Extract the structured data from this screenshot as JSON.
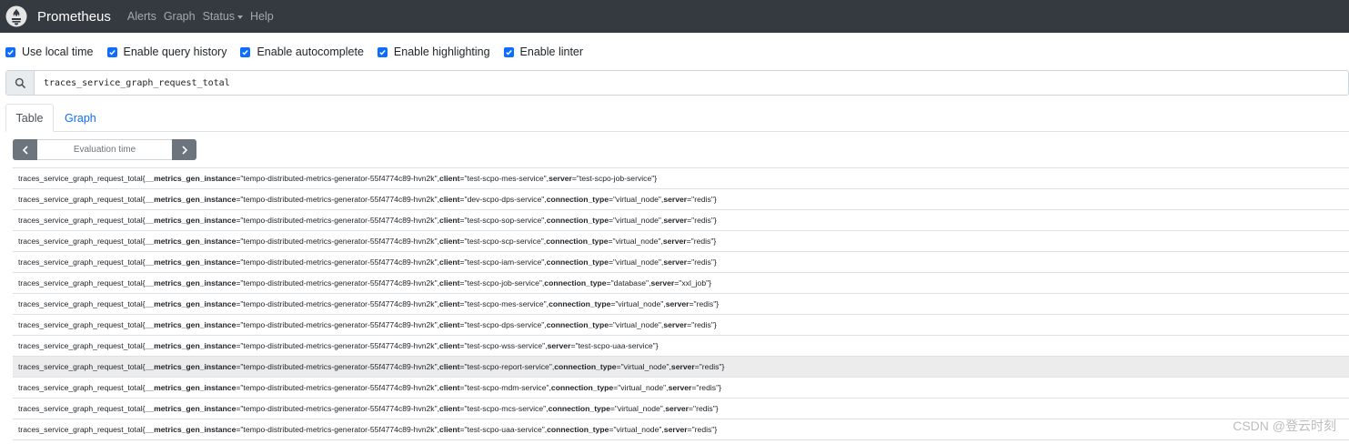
{
  "navbar": {
    "brand": "Prometheus",
    "links": {
      "alerts": "Alerts",
      "graph": "Graph",
      "status": "Status",
      "help": "Help"
    },
    "logo_icon": "prometheus-flame-icon"
  },
  "options": [
    {
      "label": "Use local time",
      "checked": true
    },
    {
      "label": "Enable query history",
      "checked": true
    },
    {
      "label": "Enable autocomplete",
      "checked": true
    },
    {
      "label": "Enable highlighting",
      "checked": true
    },
    {
      "label": "Enable linter",
      "checked": true
    }
  ],
  "query": {
    "value": "traces_service_graph_request_total",
    "icon": "search-icon"
  },
  "tabs": {
    "table": "Table",
    "graph": "Graph",
    "active": "table"
  },
  "eval": {
    "placeholder": "Evaluation time",
    "prev_icon": "chevron-left-icon",
    "next_icon": "chevron-right-icon"
  },
  "colors": {
    "navbar": "#343a40",
    "accent": "#0d6efd",
    "button": "#6c757d",
    "highlight_row": "#ececec"
  },
  "metric_name": "traces_service_graph_request_total",
  "rows": [
    {
      "labels": [
        {
          "k": "__metrics_gen_instance",
          "v": "tempo-distributed-metrics-generator-55f4774c89-hvn2k"
        },
        {
          "k": "client",
          "v": "test-scpo-mes-service"
        },
        {
          "k": "server",
          "v": "test-scpo-job-service"
        }
      ]
    },
    {
      "labels": [
        {
          "k": "__metrics_gen_instance",
          "v": "tempo-distributed-metrics-generator-55f4774c89-hvn2k"
        },
        {
          "k": "client",
          "v": "dev-scpo-dps-service"
        },
        {
          "k": "connection_type",
          "v": "virtual_node"
        },
        {
          "k": "server",
          "v": "redis"
        }
      ]
    },
    {
      "labels": [
        {
          "k": "__metrics_gen_instance",
          "v": "tempo-distributed-metrics-generator-55f4774c89-hvn2k"
        },
        {
          "k": "client",
          "v": "test-scpo-sop-service"
        },
        {
          "k": "connection_type",
          "v": "virtual_node"
        },
        {
          "k": "server",
          "v": "redis"
        }
      ]
    },
    {
      "labels": [
        {
          "k": "__metrics_gen_instance",
          "v": "tempo-distributed-metrics-generator-55f4774c89-hvn2k"
        },
        {
          "k": "client",
          "v": "test-scpo-scp-service"
        },
        {
          "k": "connection_type",
          "v": "virtual_node"
        },
        {
          "k": "server",
          "v": "redis"
        }
      ]
    },
    {
      "labels": [
        {
          "k": "__metrics_gen_instance",
          "v": "tempo-distributed-metrics-generator-55f4774c89-hvn2k"
        },
        {
          "k": "client",
          "v": "test-scpo-iam-service"
        },
        {
          "k": "connection_type",
          "v": "virtual_node"
        },
        {
          "k": "server",
          "v": "redis"
        }
      ]
    },
    {
      "labels": [
        {
          "k": "__metrics_gen_instance",
          "v": "tempo-distributed-metrics-generator-55f4774c89-hvn2k"
        },
        {
          "k": "client",
          "v": "test-scpo-job-service"
        },
        {
          "k": "connection_type",
          "v": "database"
        },
        {
          "k": "server",
          "v": "xxl_job"
        }
      ]
    },
    {
      "labels": [
        {
          "k": "__metrics_gen_instance",
          "v": "tempo-distributed-metrics-generator-55f4774c89-hvn2k"
        },
        {
          "k": "client",
          "v": "test-scpo-mes-service"
        },
        {
          "k": "connection_type",
          "v": "virtual_node"
        },
        {
          "k": "server",
          "v": "redis"
        }
      ]
    },
    {
      "labels": [
        {
          "k": "__metrics_gen_instance",
          "v": "tempo-distributed-metrics-generator-55f4774c89-hvn2k"
        },
        {
          "k": "client",
          "v": "test-scpo-dps-service"
        },
        {
          "k": "connection_type",
          "v": "virtual_node"
        },
        {
          "k": "server",
          "v": "redis"
        }
      ]
    },
    {
      "labels": [
        {
          "k": "__metrics_gen_instance",
          "v": "tempo-distributed-metrics-generator-55f4774c89-hvn2k"
        },
        {
          "k": "client",
          "v": "test-scpo-wss-service"
        },
        {
          "k": "server",
          "v": "test-scpo-uaa-service"
        }
      ]
    },
    {
      "highlighted": true,
      "labels": [
        {
          "k": "__metrics_gen_instance",
          "v": "tempo-distributed-metrics-generator-55f4774c89-hvn2k"
        },
        {
          "k": "client",
          "v": "test-scpo-report-service"
        },
        {
          "k": "connection_type",
          "v": "virtual_node"
        },
        {
          "k": "server",
          "v": "redis"
        }
      ]
    },
    {
      "labels": [
        {
          "k": "__metrics_gen_instance",
          "v": "tempo-distributed-metrics-generator-55f4774c89-hvn2k"
        },
        {
          "k": "client",
          "v": "test-scpo-mdm-service"
        },
        {
          "k": "connection_type",
          "v": "virtual_node"
        },
        {
          "k": "server",
          "v": "redis"
        }
      ]
    },
    {
      "labels": [
        {
          "k": "__metrics_gen_instance",
          "v": "tempo-distributed-metrics-generator-55f4774c89-hvn2k"
        },
        {
          "k": "client",
          "v": "test-scpo-mcs-service"
        },
        {
          "k": "connection_type",
          "v": "virtual_node"
        },
        {
          "k": "server",
          "v": "redis"
        }
      ]
    },
    {
      "labels": [
        {
          "k": "__metrics_gen_instance",
          "v": "tempo-distributed-metrics-generator-55f4774c89-hvn2k"
        },
        {
          "k": "client",
          "v": "test-scpo-uaa-service"
        },
        {
          "k": "connection_type",
          "v": "virtual_node"
        },
        {
          "k": "server",
          "v": "redis"
        }
      ]
    }
  ],
  "watermark": "CSDN @登云时刻"
}
